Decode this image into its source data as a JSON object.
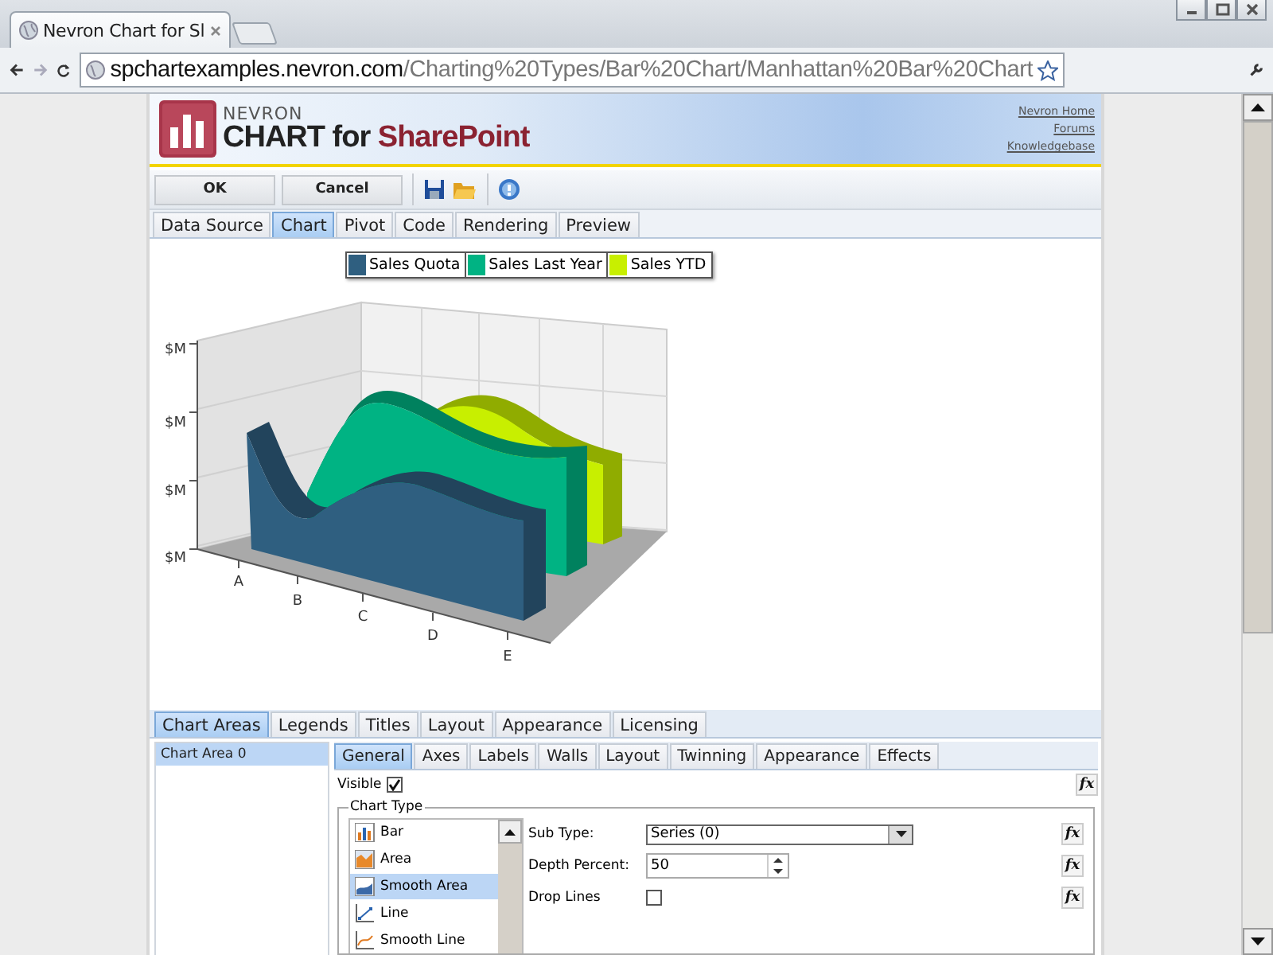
{
  "browser": {
    "tab_title": "Nevron Chart for Sl",
    "url_host": "spchartexamples.nevron.com",
    "url_path": "/Charting%20Types/Bar%20Chart/Manhattan%20Bar%20Chart"
  },
  "header": {
    "logo_small": "NEVRON",
    "logo_main": "CHART for",
    "logo_accent": "SharePoint",
    "links": [
      "Nevron Home",
      "Forums",
      "Knowledgebase"
    ]
  },
  "toolbar": {
    "buttons": [
      "OK",
      "Cancel"
    ]
  },
  "tabs": [
    {
      "label": "Data Source",
      "selected": false
    },
    {
      "label": "Chart",
      "selected": true
    },
    {
      "label": "Pivot",
      "selected": false
    },
    {
      "label": "Code",
      "selected": false
    },
    {
      "label": "Rendering",
      "selected": false
    },
    {
      "label": "Preview",
      "selected": false
    }
  ],
  "chart": {
    "legend": [
      {
        "name": "Sales Quota",
        "color": "#2f5f80"
      },
      {
        "name": "Sales Last Year",
        "color": "#00b383"
      },
      {
        "name": "Sales YTD",
        "color": "#c8ef00"
      }
    ],
    "y_labels": [
      "$M",
      "$M",
      "$M",
      "$M"
    ],
    "categories": [
      "A",
      "B",
      "C",
      "D",
      "E"
    ]
  },
  "bottom_tabs": [
    {
      "label": "Chart Areas",
      "selected": true
    },
    {
      "label": "Legends",
      "selected": false
    },
    {
      "label": "Titles",
      "selected": false
    },
    {
      "label": "Layout",
      "selected": false
    },
    {
      "label": "Appearance",
      "selected": false
    },
    {
      "label": "Licensing",
      "selected": false
    }
  ],
  "areas": [
    {
      "label": "Chart Area 0",
      "selected": true
    }
  ],
  "sub_tabs": [
    {
      "label": "General",
      "selected": true
    },
    {
      "label": "Axes",
      "selected": false
    },
    {
      "label": "Labels",
      "selected": false
    },
    {
      "label": "Walls",
      "selected": false
    },
    {
      "label": "Layout",
      "selected": false
    },
    {
      "label": "Twinning",
      "selected": false
    },
    {
      "label": "Appearance",
      "selected": false
    },
    {
      "label": "Effects",
      "selected": false
    }
  ],
  "visible": {
    "label": "Visible",
    "checked": true,
    "formula": "fx"
  },
  "chart_type": {
    "title": "Chart Type",
    "items": [
      {
        "label": "Bar",
        "kind": "bar",
        "selected": false
      },
      {
        "label": "Area",
        "kind": "area",
        "selected": false
      },
      {
        "label": "Smooth Area",
        "kind": "smooth-area",
        "selected": true
      },
      {
        "label": "Line",
        "kind": "line",
        "selected": false
      },
      {
        "label": "Smooth Line",
        "kind": "smooth-line",
        "selected": false
      }
    ]
  },
  "fields": [
    {
      "kind": "select",
      "label": "Sub Type:",
      "value": "Series (0)",
      "formula": "fx"
    },
    {
      "kind": "spin",
      "label": "Depth Percent:",
      "value": "50",
      "formula": "fx"
    },
    {
      "kind": "check",
      "label": "Drop Lines",
      "checked": false,
      "formula": "fx"
    }
  ]
}
